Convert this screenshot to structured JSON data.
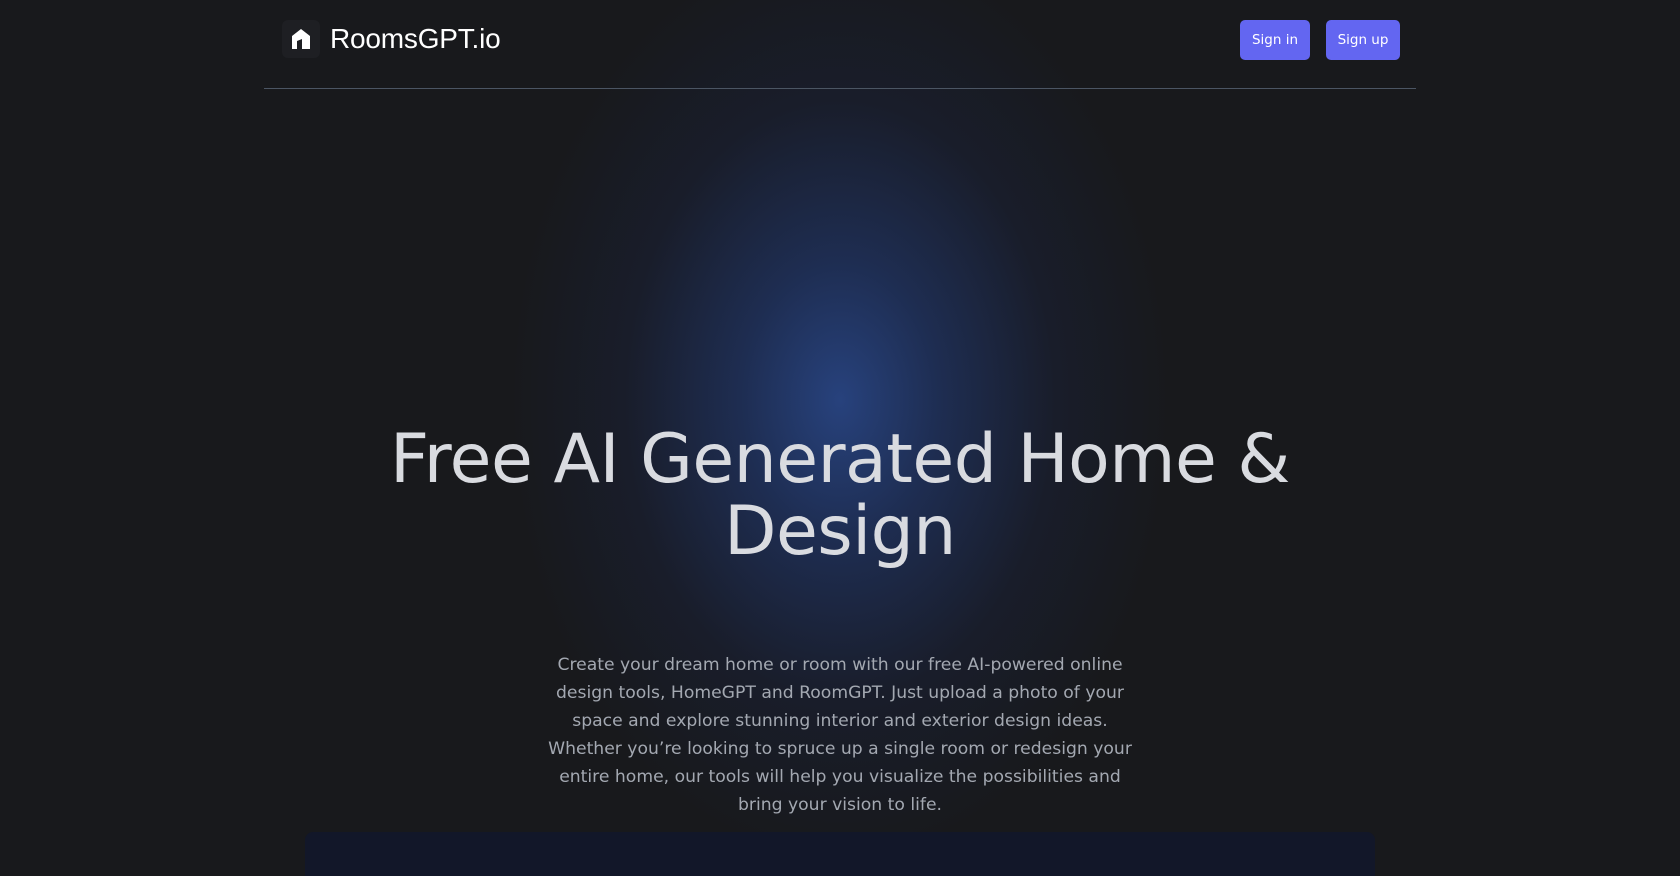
{
  "header": {
    "logo_icon": "house-icon",
    "brand_name": "RoomsGPT.io",
    "sign_in_label": "Sign in",
    "sign_up_label": "Sign up",
    "button_color": "#6366f1"
  },
  "hero": {
    "title": "Free AI Generated Home & Design",
    "description": "Create your dream home or room with our free AI-powered online design tools, HomeGPT and RoomGPT. Just upload a photo of your space and explore stunning interior and exterior design ideas. Whether you’re looking to spruce up a single room or redesign your entire home, our tools will help you visualize the possibilities and bring your vision to life."
  },
  "colors": {
    "background": "#18191c",
    "glow": "#284482",
    "preview_panel": "#121729"
  }
}
